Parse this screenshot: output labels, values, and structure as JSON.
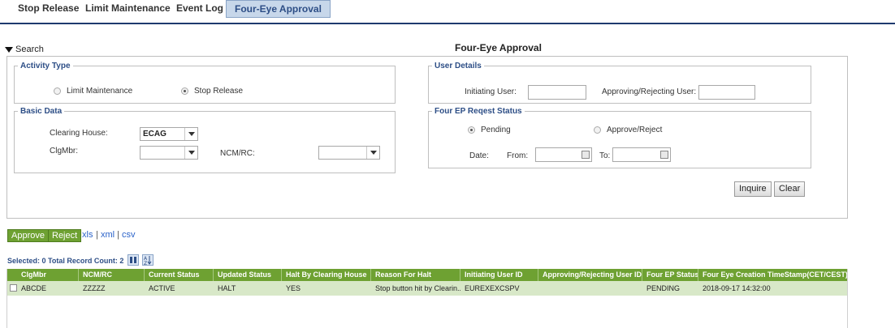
{
  "tabs": [
    {
      "label": "Stop Release"
    },
    {
      "label": "Limit Maintenance"
    },
    {
      "label": "Event Log"
    },
    {
      "label": "Four-Eye Approval"
    }
  ],
  "active_tab": "Four-Eye Approval",
  "search_toggle": "Search",
  "page_title": "Four-Eye Approval",
  "activity_type": {
    "legend": "Activity Type",
    "options": [
      {
        "label": "Limit Maintenance",
        "selected": false
      },
      {
        "label": "Stop Release",
        "selected": true
      }
    ]
  },
  "basic_data": {
    "legend": "Basic Data",
    "clearing_house_label": "Clearing House:",
    "clearing_house_value": "ECAG",
    "clgmbr_label": "ClgMbr:",
    "clgmbr_value": "",
    "ncm_label": "NCM/RC:",
    "ncm_value": ""
  },
  "user_details": {
    "legend": "User Details",
    "initiating_label": "Initiating User:",
    "initiating_value": "",
    "approving_label": "Approving/Rejecting User:",
    "approving_value": ""
  },
  "request_status": {
    "legend": "Four EP Reqest Status",
    "options": [
      {
        "label": "Pending",
        "selected": true
      },
      {
        "label": "Approve/Reject",
        "selected": false
      }
    ],
    "date_label": "Date:",
    "from_label": "From:",
    "from_value": "",
    "to_label": "To:",
    "to_value": ""
  },
  "buttons": {
    "inquire": "Inquire",
    "clear": "Clear"
  },
  "actions": {
    "approve": "Approve",
    "reject": "Reject"
  },
  "exports": {
    "xls": "xls",
    "sep1": "|",
    "xml": "xml",
    "sep2": "|",
    "csv": "csv"
  },
  "record_summary": "Selected: 0 Total Record Count: 2",
  "grid": {
    "columns": [
      "ClgMbr",
      "NCM/RC",
      "Current Status",
      "Updated Status",
      "Halt By Clearing House",
      "Reason For Halt",
      "Initiating User ID",
      "Approving/Rejecting User ID",
      "Four EP Status",
      "Four Eye Creation TimeStamp(CET/CEST)"
    ],
    "rows": [
      [
        "ABCDE",
        "ZZZZZ",
        "ACTIVE",
        "HALT",
        "YES",
        "Stop button hit by Clearin...",
        "EUREXEXCSPV",
        "",
        "PENDING",
        "2018-09-17 14:32:00"
      ]
    ]
  },
  "colors": {
    "accent_green": "#6ea132",
    "tab_active": "#c7d7ea",
    "row_selected": "#d8e8c8",
    "header_blue": "#2d4e86"
  },
  "icons": [
    "triangle-down-icon",
    "calendar-icon",
    "column-chooser-icon",
    "sort-icon",
    "dropdown-arrow-icon"
  ]
}
